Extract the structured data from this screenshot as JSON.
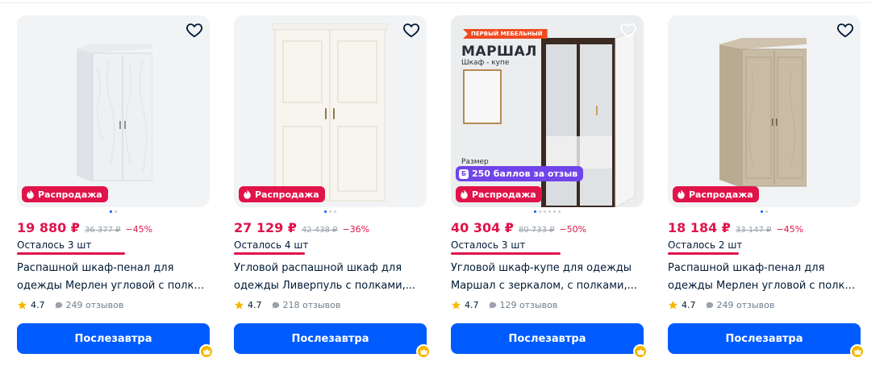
{
  "colors": {
    "accent": "#005bff",
    "sale": "#e0144a",
    "bonus": "#7044e8",
    "star": "#f5b800"
  },
  "products": [
    {
      "price": "19 880 ₽",
      "old_price": "36 377 ₽",
      "discount": "−45%",
      "stock": "Осталось 3 шт",
      "title_line1": "Распашной шкаф-пенал для",
      "title_line2": "одежды Мерлен угловой с полкам...",
      "rating": "4.7",
      "reviews": "249 отзывов",
      "sale_badge": "Распродажа",
      "button": "Послезавтра"
    },
    {
      "price": "27 129 ₽",
      "old_price": "42 438 ₽",
      "discount": "−36%",
      "stock": "Осталось 4 шт",
      "title_line1": "Угловой распашной шкаф для",
      "title_line2": "одежды Ливерпуль с полками,...",
      "rating": "4.7",
      "reviews": "218 отзывов",
      "sale_badge": "Распродажа",
      "button": "Послезавтра"
    },
    {
      "price": "40 304 ₽",
      "old_price": "80 733 ₽",
      "discount": "−50%",
      "stock": "Осталось 3 шт",
      "title_line1": "Угловой шкаф-купе для одежды",
      "title_line2": "Маршал с зеркалом, с полками,...",
      "rating": "4.7",
      "reviews": "129 отзывов",
      "sale_badge": "Распродажа",
      "button": "Послезавтра",
      "promo": {
        "tag": "ПЕРВЫЙ МЕБЕЛЬНЫЙ",
        "brand": "МАРШАЛ",
        "subtitle": "Шкаф - купе",
        "size_label": "Размер",
        "bonus": "250 баллов за отзыв",
        "bonus_icon": "Б"
      }
    },
    {
      "price": "18 184 ₽",
      "old_price": "33 147 ₽",
      "discount": "−45%",
      "stock": "Осталось 2 шт",
      "title_line1": "Распашной шкаф-пенал для",
      "title_line2": "одежды Мерлен угловой с полкам...",
      "rating": "4.7",
      "reviews": "249 отзывов",
      "sale_badge": "Распродажа",
      "button": "Послезавтра"
    }
  ]
}
